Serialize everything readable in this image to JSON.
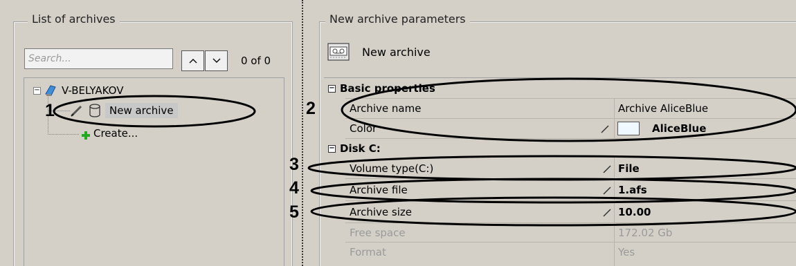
{
  "left_panel": {
    "title": "List of archives",
    "search": {
      "placeholder": "Search...",
      "value": ""
    },
    "counter": "0 of 0",
    "tree": {
      "host": "V-BELYAKOV",
      "archive": "New archive",
      "create": "Create..."
    }
  },
  "right_panel": {
    "title": "New archive parameters",
    "archive_label": "New archive",
    "sections": {
      "basic": "Basic properties",
      "disk": "Disk C:"
    },
    "properties": {
      "archive_name": {
        "label": "Archive name",
        "value": "Archive AliceBlue"
      },
      "color": {
        "label": "Color",
        "value": "AliceBlue",
        "swatch": "#F0F8FF"
      },
      "volume_type": {
        "label": "Volume type(C:)",
        "value": "File"
      },
      "archive_file": {
        "label": "Archive file",
        "value": "1.afs"
      },
      "archive_size": {
        "label": "Archive size",
        "value": "10.00"
      },
      "free_space": {
        "label": "Free space",
        "value": "172.02 Gb"
      },
      "format": {
        "label": "Format",
        "value": "Yes"
      }
    }
  },
  "annotations": {
    "m1": "1",
    "m2": "2",
    "m3": "3",
    "m4": "4",
    "m5": "5"
  },
  "icons": {
    "host": "computer-icon",
    "archive_edit": "pencil-icon",
    "archive": "database-icon",
    "create": "plus-icon",
    "header": "archive-tape-icon",
    "edit": "pencil-icon"
  },
  "colors": {
    "background": "#d4d0c8",
    "swatch": "#F0F8FF",
    "plus": "#22aa22"
  }
}
